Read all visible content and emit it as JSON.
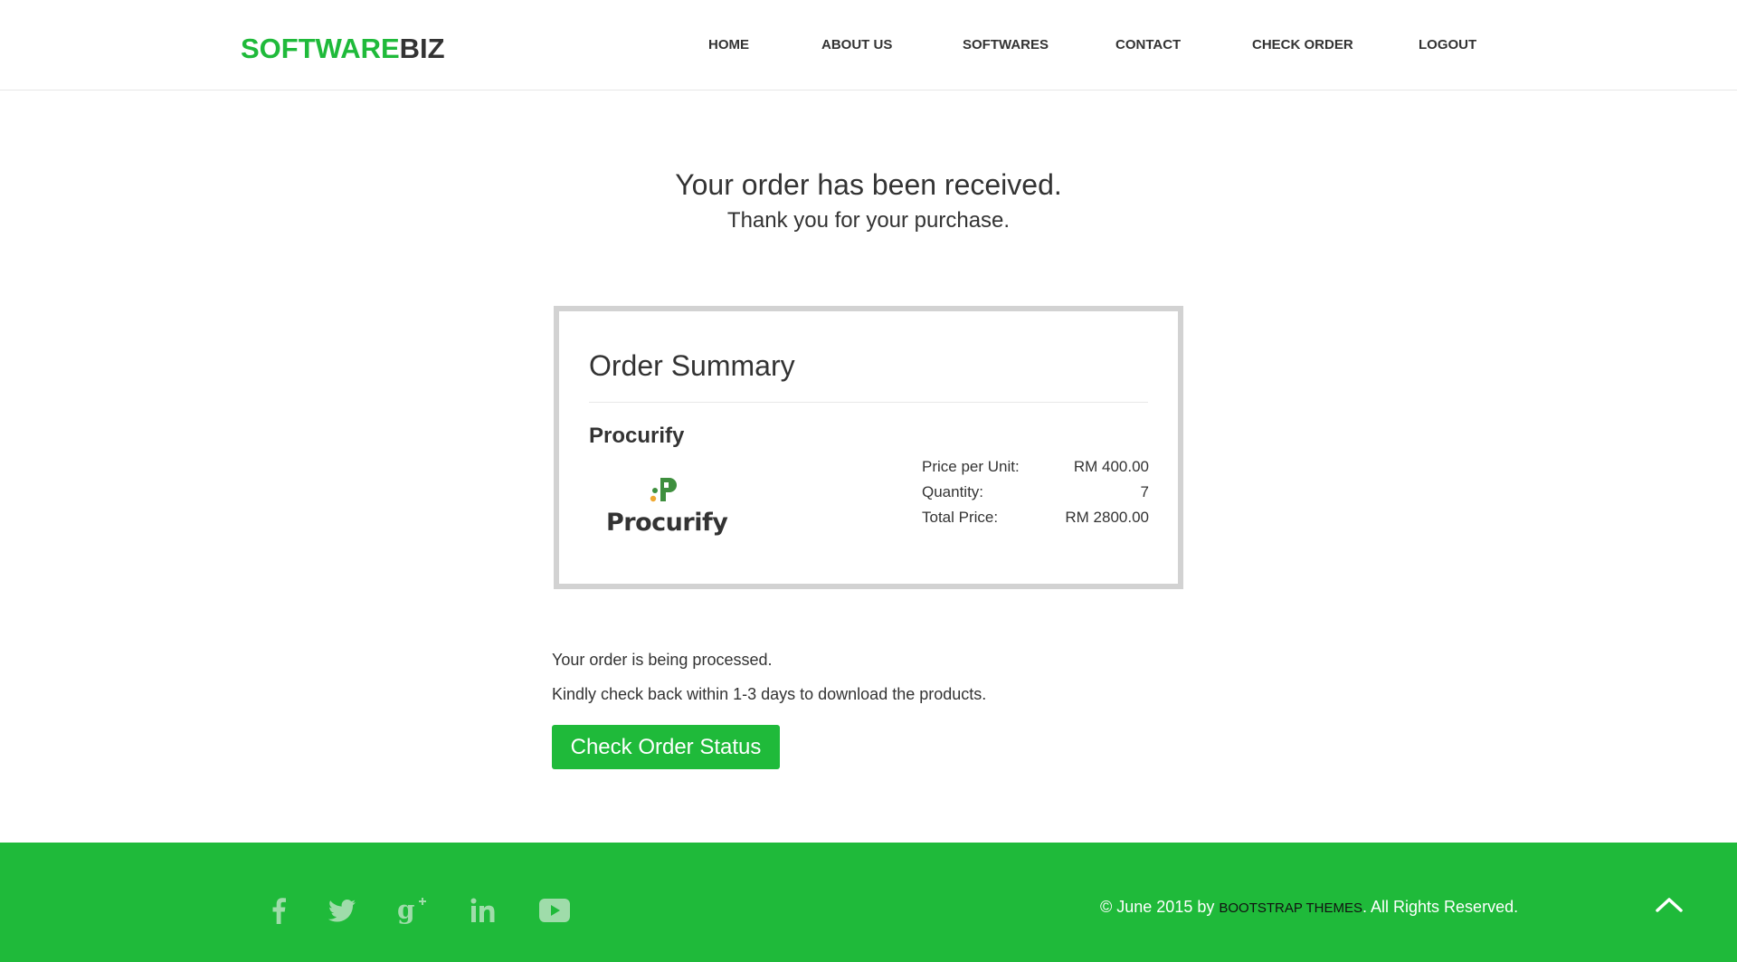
{
  "brand": {
    "part1": "SOFTWARE",
    "part2": "BIZ"
  },
  "nav": {
    "home": "HOME",
    "about": "ABOUT US",
    "softwares": "SOFTWARES",
    "contact": "CONTACT",
    "check_order": "CHECK ORDER",
    "logout": "LOGOUT"
  },
  "confirmation": {
    "heading": "Your order has been received.",
    "subheading": "Thank you for your purchase."
  },
  "order_summary": {
    "title": "Order Summary",
    "product_name": "Procurify",
    "product_logo_text": "Procurify",
    "rows": [
      {
        "label": "Price per Unit:",
        "value": "RM 400.00"
      },
      {
        "label": "Quantity:",
        "value": "7"
      },
      {
        "label": "Total Price:",
        "value": "RM 2800.00"
      }
    ]
  },
  "status": {
    "line1": "Your order is being processed.",
    "line2": "Kindly check back within 1-3 days to download the products.",
    "button": "Check Order Status"
  },
  "footer": {
    "copyright_pre": "© June 2015 by ",
    "copyright_link": "BOOTSTRAP THEMES",
    "copyright_post": ". All Rights Reserved.",
    "social_icons": [
      "facebook-icon",
      "twitter-icon",
      "google-plus-icon",
      "linkedin-icon",
      "youtube-icon"
    ],
    "scroll_top_icon": "chevron-up-icon"
  },
  "colors": {
    "accent": "#1fba3a",
    "text": "#333333",
    "footer_icon": "#9fdcaa",
    "box_border": "#d2d2d2"
  }
}
